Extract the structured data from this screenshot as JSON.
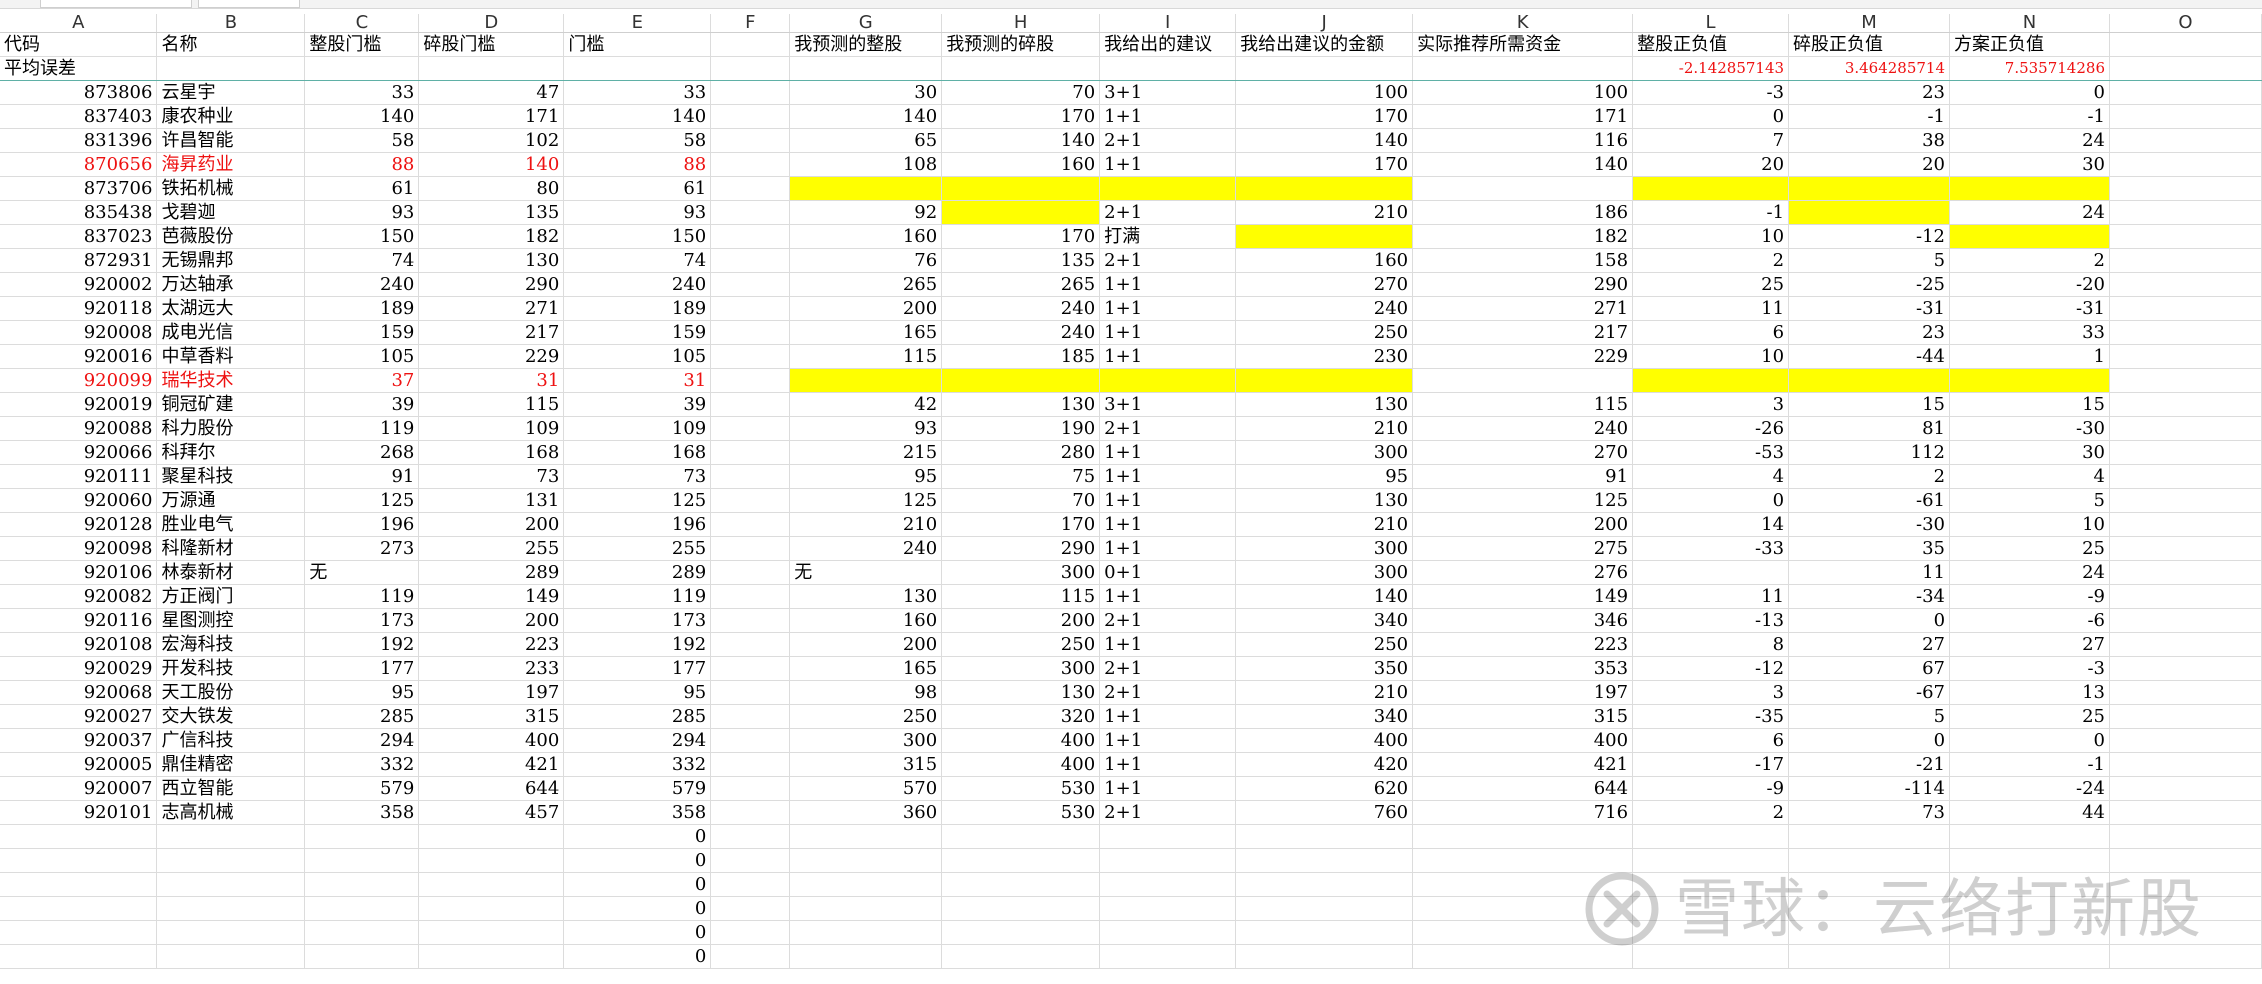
{
  "columns": [
    "A",
    "B",
    "C",
    "D",
    "E",
    "F",
    "G",
    "H",
    "I",
    "J",
    "K",
    "L",
    "M",
    "N",
    "O"
  ],
  "header_row": [
    "代码",
    "名称",
    "整股门槛",
    "碎股门槛",
    "门槛",
    "",
    "我预测的整股",
    "我预测的碎股",
    "我给出的建议",
    "我给出建议的金额",
    "实际推荐所需资金",
    "整股正负值",
    "碎股正负值",
    "方案正负值",
    ""
  ],
  "avg_row": {
    "label": "平均误差",
    "L": "-2.142857143",
    "M": "3.464285714",
    "N": "7.535714286"
  },
  "rows": [
    {
      "A": "873806",
      "B": "云星宇",
      "C": "33",
      "D": "47",
      "E": "33",
      "G": "30",
      "H": "70",
      "I": "3+1",
      "J": "100",
      "K": "100",
      "L": "-3",
      "M": "23",
      "N": "0"
    },
    {
      "A": "837403",
      "B": "康农种业",
      "C": "140",
      "D": "171",
      "E": "140",
      "G": "140",
      "H": "170",
      "I": "1+1",
      "J": "170",
      "K": "171",
      "L": "0",
      "M": "-1",
      "N": "-1"
    },
    {
      "A": "831396",
      "B": "许昌智能",
      "C": "58",
      "D": "102",
      "E": "58",
      "G": "65",
      "H": "140",
      "I": "2+1",
      "J": "140",
      "K": "116",
      "L": "7",
      "M": "38",
      "N": "24"
    },
    {
      "A": "870656",
      "B": "海昇药业",
      "C": "88",
      "D": "140",
      "E": "88",
      "G": "108",
      "H": "160",
      "I": "1+1",
      "J": "170",
      "K": "140",
      "L": "20",
      "M": "20",
      "N": "30",
      "red": true
    },
    {
      "A": "873706",
      "B": "铁拓机械",
      "C": "61",
      "D": "80",
      "E": "61",
      "G": "",
      "H": "",
      "I": "",
      "J": "",
      "K": "",
      "L": "",
      "M": "",
      "N": "",
      "yellow": [
        "G",
        "H",
        "I",
        "J",
        "L",
        "M",
        "N"
      ]
    },
    {
      "A": "835438",
      "B": "戈碧迦",
      "C": "93",
      "D": "135",
      "E": "93",
      "G": "92",
      "H": "",
      "I": "2+1",
      "J": "210",
      "K": "186",
      "L": "-1",
      "M": "",
      "N": "24",
      "yellow": [
        "H",
        "M"
      ]
    },
    {
      "A": "837023",
      "B": "芭薇股份",
      "C": "150",
      "D": "182",
      "E": "150",
      "G": "160",
      "H": "170",
      "I": "打满",
      "J": "",
      "K": "182",
      "L": "10",
      "M": "-12",
      "N": "",
      "yellow": [
        "J",
        "N"
      ]
    },
    {
      "A": "872931",
      "B": "无锡鼎邦",
      "C": "74",
      "D": "130",
      "E": "74",
      "G": "76",
      "H": "135",
      "I": "2+1",
      "J": "160",
      "K": "158",
      "L": "2",
      "M": "5",
      "N": "2"
    },
    {
      "A": "920002",
      "B": "万达轴承",
      "C": "240",
      "D": "290",
      "E": "240",
      "G": "265",
      "H": "265",
      "I": "1+1",
      "J": "270",
      "K": "290",
      "L": "25",
      "M": "-25",
      "N": "-20"
    },
    {
      "A": "920118",
      "B": "太湖远大",
      "C": "189",
      "D": "271",
      "E": "189",
      "G": "200",
      "H": "240",
      "I": "1+1",
      "J": "240",
      "K": "271",
      "L": "11",
      "M": "-31",
      "N": "-31"
    },
    {
      "A": "920008",
      "B": "成电光信",
      "C": "159",
      "D": "217",
      "E": "159",
      "G": "165",
      "H": "240",
      "I": "1+1",
      "J": "250",
      "K": "217",
      "L": "6",
      "M": "23",
      "N": "33"
    },
    {
      "A": "920016",
      "B": "中草香料",
      "C": "105",
      "D": "229",
      "E": "105",
      "G": "115",
      "H": "185",
      "I": "1+1",
      "J": "230",
      "K": "229",
      "L": "10",
      "M": "-44",
      "N": "1"
    },
    {
      "A": "920099",
      "B": "瑞华技术",
      "C": "37",
      "D": "31",
      "E": "31",
      "G": "",
      "H": "",
      "I": "",
      "J": "",
      "K": "",
      "L": "",
      "M": "",
      "N": "",
      "red": true,
      "yellow": [
        "G",
        "H",
        "I",
        "J",
        "L",
        "M",
        "N"
      ]
    },
    {
      "A": "920019",
      "B": "铜冠矿建",
      "C": "39",
      "D": "115",
      "E": "39",
      "G": "42",
      "H": "130",
      "I": "3+1",
      "J": "130",
      "K": "115",
      "L": "3",
      "M": "15",
      "N": "15"
    },
    {
      "A": "920088",
      "B": "科力股份",
      "C": "119",
      "D": "109",
      "E": "109",
      "G": "93",
      "H": "190",
      "I": "2+1",
      "J": "210",
      "K": "240",
      "L": "-26",
      "M": "81",
      "N": "-30"
    },
    {
      "A": "920066",
      "B": "科拜尔",
      "C": "268",
      "D": "168",
      "E": "168",
      "G": "215",
      "H": "280",
      "I": "1+1",
      "J": "300",
      "K": "270",
      "L": "-53",
      "M": "112",
      "N": "30"
    },
    {
      "A": "920111",
      "B": "聚星科技",
      "C": "91",
      "D": "73",
      "E": "73",
      "G": "95",
      "H": "75",
      "I": "1+1",
      "J": "95",
      "K": "91",
      "L": "4",
      "M": "2",
      "N": "4"
    },
    {
      "A": "920060",
      "B": "万源通",
      "C": "125",
      "D": "131",
      "E": "125",
      "G": "125",
      "H": "70",
      "I": "1+1",
      "J": "130",
      "K": "125",
      "L": "0",
      "M": "-61",
      "N": "5"
    },
    {
      "A": "920128",
      "B": "胜业电气",
      "C": "196",
      "D": "200",
      "E": "196",
      "G": "210",
      "H": "170",
      "I": "1+1",
      "J": "210",
      "K": "200",
      "L": "14",
      "M": "-30",
      "N": "10"
    },
    {
      "A": "920098",
      "B": "科隆新材",
      "C": "273",
      "D": "255",
      "E": "255",
      "G": "240",
      "H": "290",
      "I": "1+1",
      "J": "300",
      "K": "275",
      "L": "-33",
      "M": "35",
      "N": "25"
    },
    {
      "A": "920106",
      "B": "林泰新材",
      "C": "无",
      "D": "289",
      "E": "289",
      "G": "无",
      "H": "300",
      "I": "0+1",
      "J": "300",
      "K": "276",
      "L": "",
      "M": "11",
      "N": "24",
      "leftC": true,
      "leftG": true
    },
    {
      "A": "920082",
      "B": "方正阀门",
      "C": "119",
      "D": "149",
      "E": "119",
      "G": "130",
      "H": "115",
      "I": "1+1",
      "J": "140",
      "K": "149",
      "L": "11",
      "M": "-34",
      "N": "-9"
    },
    {
      "A": "920116",
      "B": "星图测控",
      "C": "173",
      "D": "200",
      "E": "173",
      "G": "160",
      "H": "200",
      "I": "2+1",
      "J": "340",
      "K": "346",
      "L": "-13",
      "M": "0",
      "N": "-6"
    },
    {
      "A": "920108",
      "B": "宏海科技",
      "C": "192",
      "D": "223",
      "E": "192",
      "G": "200",
      "H": "250",
      "I": "1+1",
      "J": "250",
      "K": "223",
      "L": "8",
      "M": "27",
      "N": "27"
    },
    {
      "A": "920029",
      "B": "开发科技",
      "C": "177",
      "D": "233",
      "E": "177",
      "G": "165",
      "H": "300",
      "I": "2+1",
      "J": "350",
      "K": "353",
      "L": "-12",
      "M": "67",
      "N": "-3"
    },
    {
      "A": "920068",
      "B": "天工股份",
      "C": "95",
      "D": "197",
      "E": "95",
      "G": "98",
      "H": "130",
      "I": "2+1",
      "J": "210",
      "K": "197",
      "L": "3",
      "M": "-67",
      "N": "13"
    },
    {
      "A": "920027",
      "B": "交大铁发",
      "C": "285",
      "D": "315",
      "E": "285",
      "G": "250",
      "H": "320",
      "I": "1+1",
      "J": "340",
      "K": "315",
      "L": "-35",
      "M": "5",
      "N": "25"
    },
    {
      "A": "920037",
      "B": "广信科技",
      "C": "294",
      "D": "400",
      "E": "294",
      "G": "300",
      "H": "400",
      "I": "1+1",
      "J": "400",
      "K": "400",
      "L": "6",
      "M": "0",
      "N": "0"
    },
    {
      "A": "920005",
      "B": "鼎佳精密",
      "C": "332",
      "D": "421",
      "E": "332",
      "G": "315",
      "H": "400",
      "I": "1+1",
      "J": "420",
      "K": "421",
      "L": "-17",
      "M": "-21",
      "N": "-1"
    },
    {
      "A": "920007",
      "B": "西立智能",
      "C": "579",
      "D": "644",
      "E": "579",
      "G": "570",
      "H": "530",
      "I": "1+1",
      "J": "620",
      "K": "644",
      "L": "-9",
      "M": "-114",
      "N": "-24"
    },
    {
      "A": "920101",
      "B": "志高机械",
      "C": "358",
      "D": "457",
      "E": "358",
      "G": "360",
      "H": "530",
      "I": "2+1",
      "J": "760",
      "K": "716",
      "L": "2",
      "M": "73",
      "N": "44"
    },
    {
      "E": "0"
    },
    {
      "E": "0"
    },
    {
      "E": "0"
    },
    {
      "E": "0"
    },
    {
      "E": "0"
    },
    {
      "E": "0"
    }
  ],
  "watermark": {
    "text": "雪球：云络打新股",
    "icon": "xueqiu-logo-icon"
  },
  "colors": {
    "highlight": "#ffff00",
    "red_text": "#e11111"
  }
}
